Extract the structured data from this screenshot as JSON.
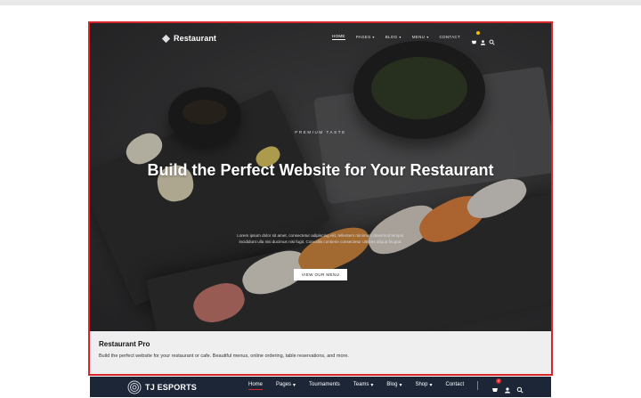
{
  "hero": {
    "logo_text": "Restaurant",
    "nav": [
      {
        "label": "HOME",
        "active": true,
        "dropdown": false
      },
      {
        "label": "PAGES",
        "active": false,
        "dropdown": true
      },
      {
        "label": "BLOG",
        "active": false,
        "dropdown": true
      },
      {
        "label": "MENU",
        "active": false,
        "dropdown": true
      },
      {
        "label": "CONTACT",
        "active": false,
        "dropdown": false
      }
    ],
    "icons": [
      "cart-icon",
      "user-icon",
      "search-icon"
    ],
    "eyebrow": "PREMIUM TASTE",
    "headline": "Build the Perfect Website for Your Restaurant",
    "body": "Lorem ipsum dolor sit amet, consectetur adipiscing elit, tellentem minimum doesmod tempor incididunt ulla nisi ducimus nisi fugit. Convallis contiene consectetur ultrices aliqua feugiat.",
    "cta": "VIEW OUR MENU"
  },
  "template": {
    "title": "Restaurant Pro",
    "description": "Build the perfect website for your restaurant or cafe. Beautiful menus, online ordering, table reservations, and more."
  },
  "esports": {
    "logo_text": "TJ ESPORTS",
    "nav": [
      {
        "label": "Home",
        "active": true,
        "dropdown": false
      },
      {
        "label": "Pages",
        "active": false,
        "dropdown": true
      },
      {
        "label": "Tournaments",
        "active": false,
        "dropdown": false
      },
      {
        "label": "Teams",
        "active": false,
        "dropdown": true
      },
      {
        "label": "Blog",
        "active": false,
        "dropdown": true
      },
      {
        "label": "Shop",
        "active": false,
        "dropdown": true
      },
      {
        "label": "Contact",
        "active": false,
        "dropdown": false
      }
    ],
    "cart_count": "0",
    "icons": [
      "cart-icon",
      "user-icon",
      "search-icon"
    ]
  },
  "colors": {
    "selection_border": "#d6262b",
    "esports_bar": "#1c2637",
    "esports_active_underline": "#d6262b",
    "cart_badge": "#f2c100",
    "card_footer_bg": "#efefef"
  }
}
